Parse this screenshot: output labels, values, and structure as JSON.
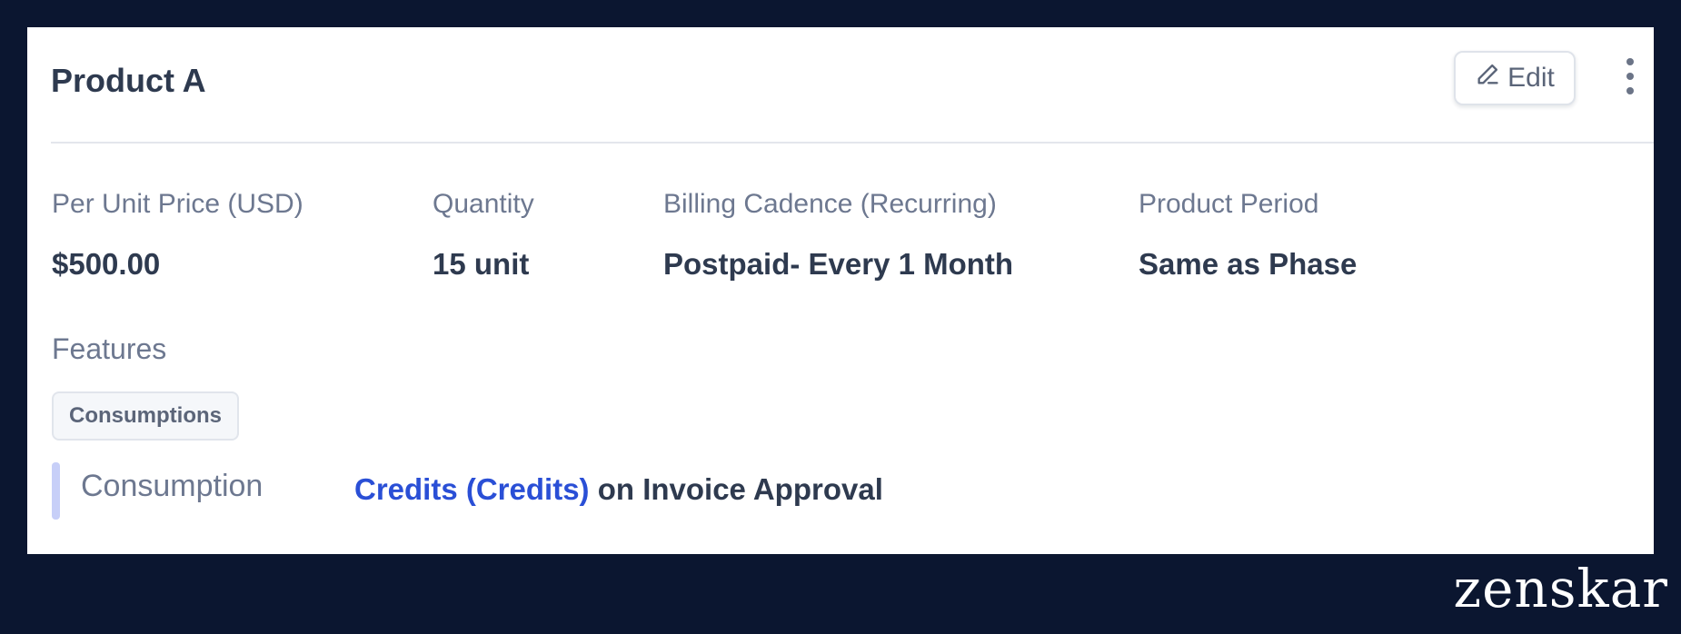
{
  "card": {
    "title": "Product A",
    "edit_label": "Edit",
    "edit_icon": "pencil-icon",
    "more_icon": "more-vertical-icon"
  },
  "fields": [
    {
      "label": "Per Unit Price (USD)",
      "value": "$500.00"
    },
    {
      "label": "Quantity",
      "value": "15 unit"
    },
    {
      "label": "Billing Cadence (Recurring)",
      "value": "Postpaid- Every 1 Month"
    },
    {
      "label": "Product Period",
      "value": "Same as Phase"
    }
  ],
  "features": {
    "label": "Features",
    "chip": "Consumptions",
    "consumption": {
      "label": "Consumption",
      "credits_link": "Credits (Credits)",
      "suffix": " on Invoice Approval"
    }
  },
  "brand": "zenskar",
  "colors": {
    "background": "#0b1630",
    "card": "#ffffff",
    "link": "#2a4fd6",
    "accent_bar": "#c7cff8"
  }
}
